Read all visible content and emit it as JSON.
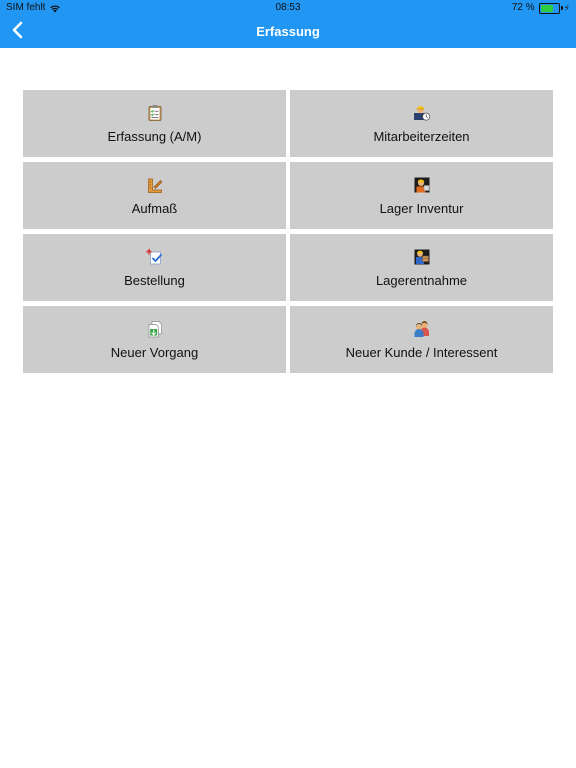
{
  "status_bar": {
    "carrier": "SIM fehlt",
    "time": "08:53",
    "battery_percent": "72 %",
    "battery_level": 0.72
  },
  "nav": {
    "title": "Erfassung",
    "back_icon": "chevron-left-icon"
  },
  "colors": {
    "header_bg": "#2196f3",
    "tile_bg": "#cccccc",
    "page_bg": "#ffffff"
  },
  "tiles": [
    {
      "label": "Erfassung (A/M)",
      "icon": "clipboard-checklist-icon"
    },
    {
      "label": "Mitarbeiterzeiten",
      "icon": "worker-time-icon"
    },
    {
      "label": "Aufmaß",
      "icon": "measuring-tool-icon"
    },
    {
      "label": "Lager Inventur",
      "icon": "inventory-worker-icon"
    },
    {
      "label": "Bestellung",
      "icon": "order-check-icon"
    },
    {
      "label": "Lagerentnahme",
      "icon": "stock-withdrawal-icon"
    },
    {
      "label": "Neuer Vorgang",
      "icon": "new-document-icon"
    },
    {
      "label": "Neuer Kunde / Interessent",
      "icon": "new-customer-icon"
    }
  ]
}
